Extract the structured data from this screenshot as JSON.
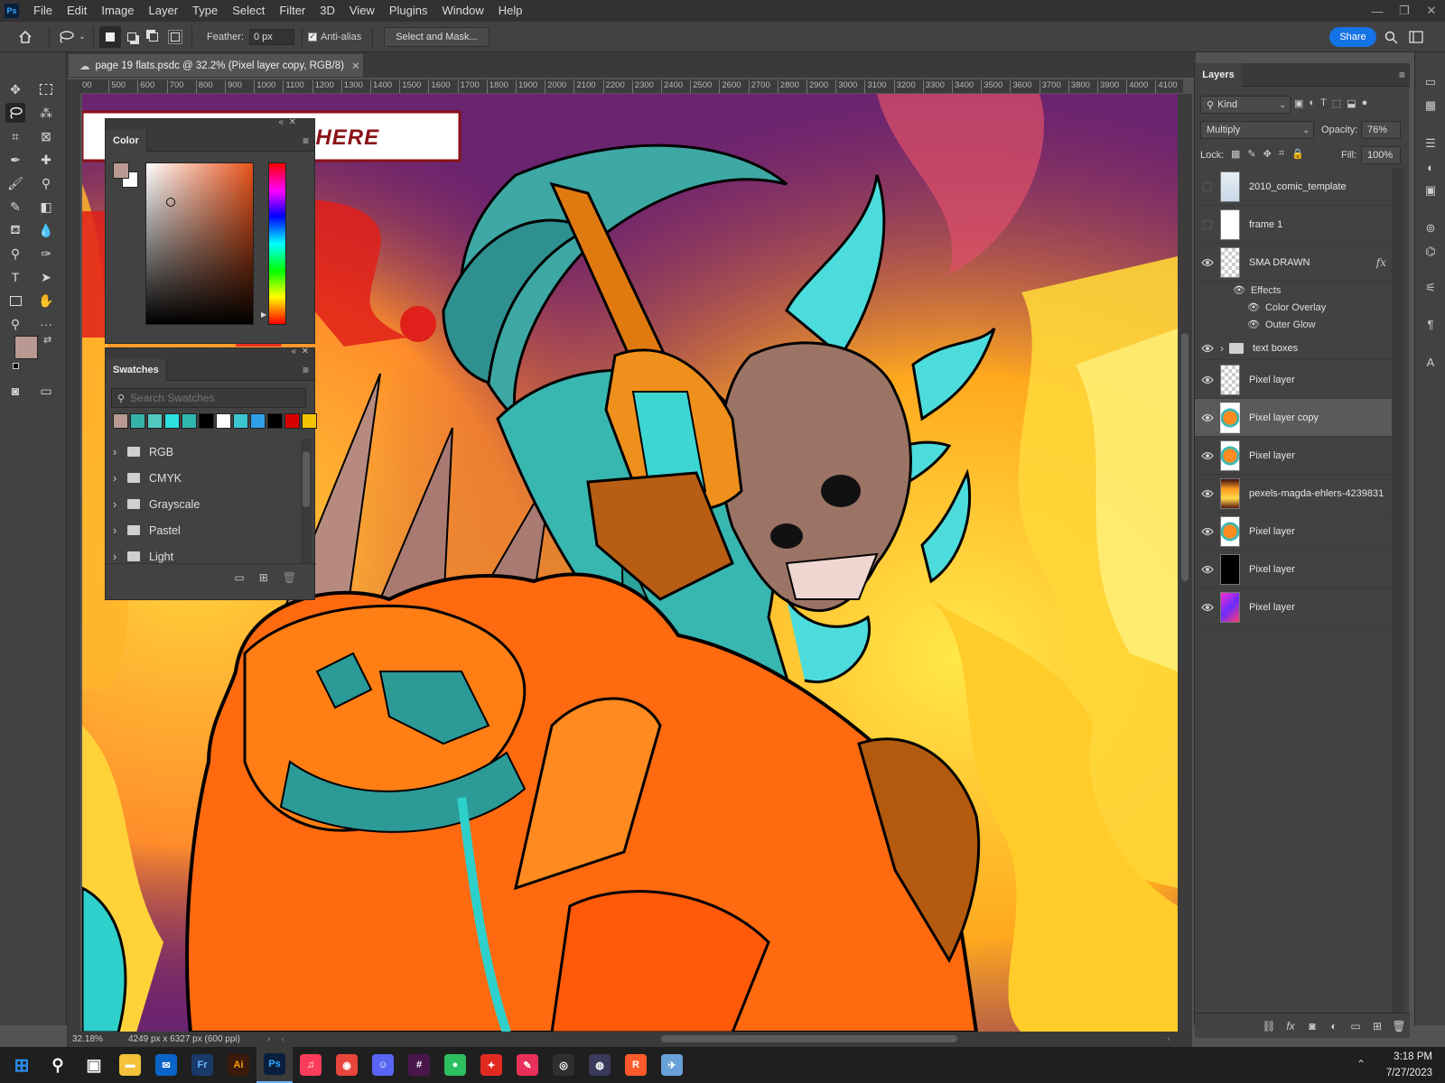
{
  "app": {
    "logo": "Ps"
  },
  "menu": [
    "File",
    "Edit",
    "Image",
    "Layer",
    "Type",
    "Select",
    "Filter",
    "3D",
    "View",
    "Plugins",
    "Window",
    "Help"
  ],
  "window_controls": [
    "minimize-icon",
    "restore-icon",
    "close-icon"
  ],
  "options": {
    "feather_label": "Feather:",
    "feather_value": "0 px",
    "antialias_label": "Anti-alias",
    "antialias_checked": true,
    "select_mask_label": "Select and Mask...",
    "share_label": "Share"
  },
  "document": {
    "tab_title": "page 19 flats.psdc @ 32.2% (Pixel layer copy, RGB/8)",
    "zoom": "32.18%",
    "dimensions": "4249 px x 6327 px (600 ppi)"
  },
  "ruler_ticks": [
    "00",
    "500",
    "600",
    "700",
    "800",
    "900",
    "1000",
    "1100",
    "1200",
    "1300",
    "1400",
    "1500",
    "1600",
    "1700",
    "1800",
    "1900",
    "2000",
    "2100",
    "2200",
    "2300",
    "2400",
    "2500",
    "2600",
    "2700",
    "2800",
    "2900",
    "3000",
    "3100",
    "3200",
    "3300",
    "3400",
    "3500",
    "3600",
    "3700",
    "3800",
    "3900",
    "4000",
    "4100"
  ],
  "artwork": {
    "caption_text": "HE ERFUL IS HERE"
  },
  "color_panel": {
    "tab": "Color",
    "foreground": "#b89a92",
    "background": "#ffffff",
    "hue_color": "#e8521a"
  },
  "swatches_panel": {
    "tab": "Swatches",
    "search_placeholder": "Search Swatches",
    "recent_colors": [
      "#b89a92",
      "#36b3a9",
      "#52c8c0",
      "#2de0e0",
      "#2fb8b0",
      "#000000",
      "#ffffff",
      "#3ac5d0",
      "#2f9fe8",
      "#000000",
      "#d60000",
      "#f5c400"
    ],
    "folders": [
      "RGB",
      "CMYK",
      "Grayscale",
      "Pastel",
      "Light"
    ]
  },
  "layers_panel": {
    "tab": "Layers",
    "filter_kind": "Kind",
    "blend_mode": "Multiply",
    "opacity_label": "Opacity:",
    "opacity_value": "76%",
    "lock_label": "Lock:",
    "fill_label": "Fill:",
    "fill_value": "100%",
    "layers": [
      {
        "name": "2010_comic_template",
        "visible": false,
        "thumb": "template"
      },
      {
        "name": "frame 1",
        "visible": false,
        "thumb": "white"
      },
      {
        "name": "SMA DRAWN",
        "visible": true,
        "thumb": "checker",
        "fx": "fx"
      },
      {
        "name": "text boxes",
        "visible": true,
        "thumb": "folder"
      },
      {
        "name": "Pixel layer",
        "visible": true,
        "thumb": "checker"
      },
      {
        "name": "Pixel layer copy",
        "visible": true,
        "thumb": "art",
        "selected": true
      },
      {
        "name": "Pixel layer",
        "visible": true,
        "thumb": "art"
      },
      {
        "name": "pexels-magda-ehlers-4239831",
        "visible": true,
        "thumb": "fire"
      },
      {
        "name": "Pixel layer",
        "visible": true,
        "thumb": "art"
      },
      {
        "name": "Pixel layer",
        "visible": true,
        "thumb": "black"
      },
      {
        "name": "Pixel layer",
        "visible": true,
        "thumb": "gradient"
      }
    ],
    "effects_label": "Effects",
    "effects": [
      "Color Overlay",
      "Outer Glow"
    ]
  },
  "taskbar": {
    "apps": [
      "start-icon",
      "search-icon",
      "task-view-icon",
      "file-explorer-icon",
      "mail-icon",
      "fresco-icon",
      "illustrator-icon",
      "photoshop-icon",
      "music-icon",
      "chrome-icon",
      "discord-icon",
      "slack-icon",
      "evernote-icon",
      "app-red-icon",
      "app-pen-icon",
      "obs-icon",
      "app-circle-icon",
      "app-orange-icon",
      "app-bird-icon"
    ],
    "time": "3:18 PM",
    "date": "7/27/2023"
  }
}
